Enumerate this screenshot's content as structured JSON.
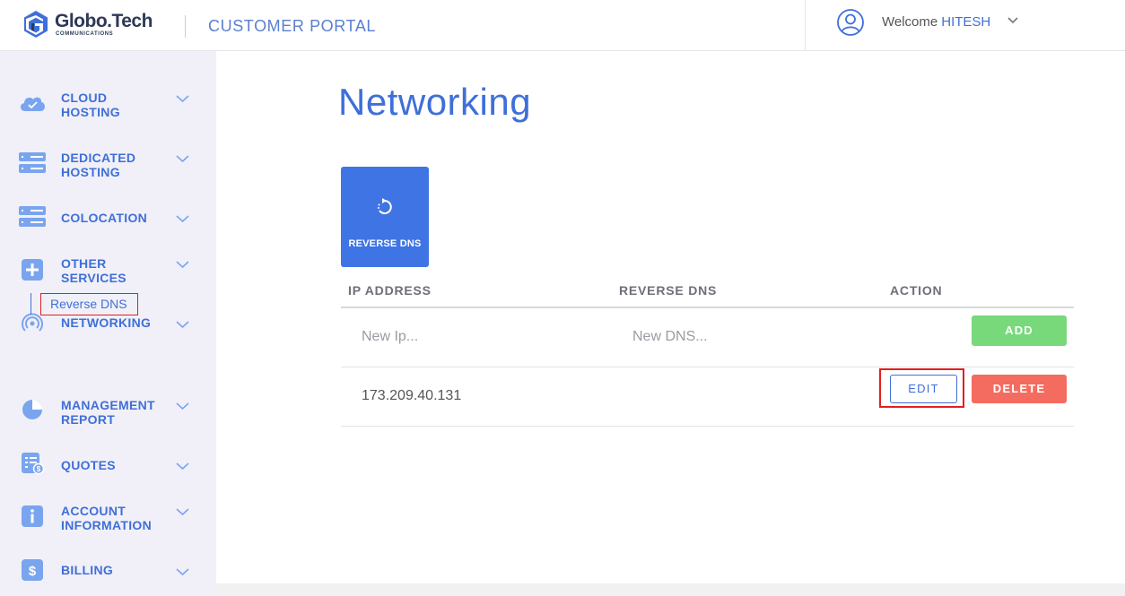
{
  "header": {
    "logo_text": "Globo.Tech",
    "logo_sub": "COMMUNICATIONS",
    "portal_title": "CUSTOMER PORTAL",
    "welcome_label": "Welcome",
    "username": "HITESH"
  },
  "sidebar": {
    "items": [
      {
        "label": "CLOUD HOSTING",
        "icon": "cloud-icon"
      },
      {
        "label": "DEDICATED HOSTING",
        "icon": "server-icon"
      },
      {
        "label": "COLOCATION",
        "icon": "server-icon"
      },
      {
        "label": "OTHER SERVICES",
        "icon": "plus-icon"
      },
      {
        "label": "NETWORKING",
        "icon": "network-icon"
      },
      {
        "label": "MANAGEMENT REPORT",
        "icon": "pie-chart-icon"
      },
      {
        "label": "QUOTES",
        "icon": "quote-list-icon"
      },
      {
        "label": "ACCOUNT INFORMATION",
        "icon": "info-icon"
      },
      {
        "label": "BILLING",
        "icon": "dollar-icon"
      }
    ],
    "subitem": "Reverse DNS"
  },
  "main": {
    "title": "Networking",
    "tile_label": "REVERSE DNS",
    "table": {
      "headers": [
        "IP ADDRESS",
        "REVERSE DNS",
        "ACTION"
      ],
      "ip_placeholder": "New Ip...",
      "dns_placeholder": "New DNS...",
      "add_label": "ADD",
      "rows": [
        {
          "ip": "173.209.40.131",
          "dns": "",
          "edit_label": "EDIT",
          "delete_label": "DELETE"
        }
      ]
    }
  },
  "colors": {
    "accent": "#3f6fd8",
    "sidebar_bg": "#f1f0f8",
    "add": "#78d97b",
    "delete": "#f46b5f",
    "highlight": "#e21f1f"
  }
}
